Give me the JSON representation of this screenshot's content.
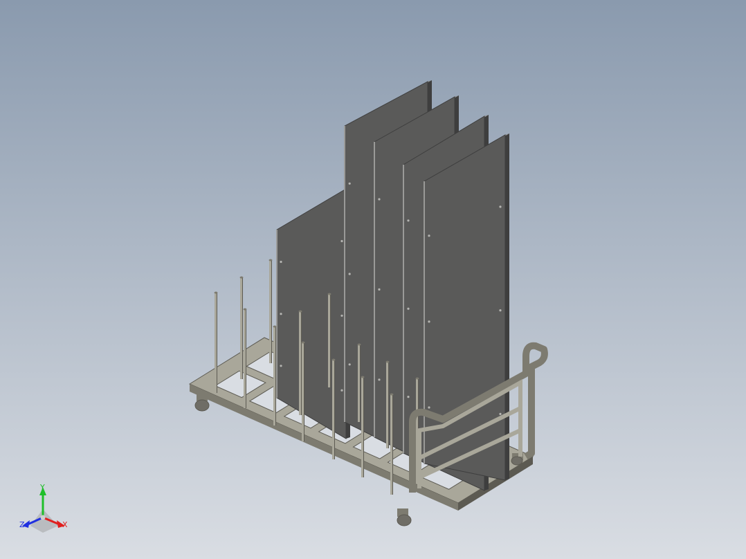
{
  "viewport": {
    "background_top": "#8a9aae",
    "background_bottom": "#d9dde3"
  },
  "model": {
    "frame_color": "#a9a79a",
    "frame_shadow": "#7d7b70",
    "frame_dark": "#5c5a52",
    "panel_face": "#5a5a59",
    "panel_edge": "#9a9a98",
    "panel_side": "#3e3e3e",
    "hole_color": "#b5b5b2",
    "caster_color": "#6f6d66"
  },
  "triad": {
    "x_label": "X",
    "y_label": "Y",
    "z_label": "Z",
    "x_color": "#e01f1f",
    "y_color": "#1fbf2a",
    "z_color": "#1f2fe0"
  }
}
